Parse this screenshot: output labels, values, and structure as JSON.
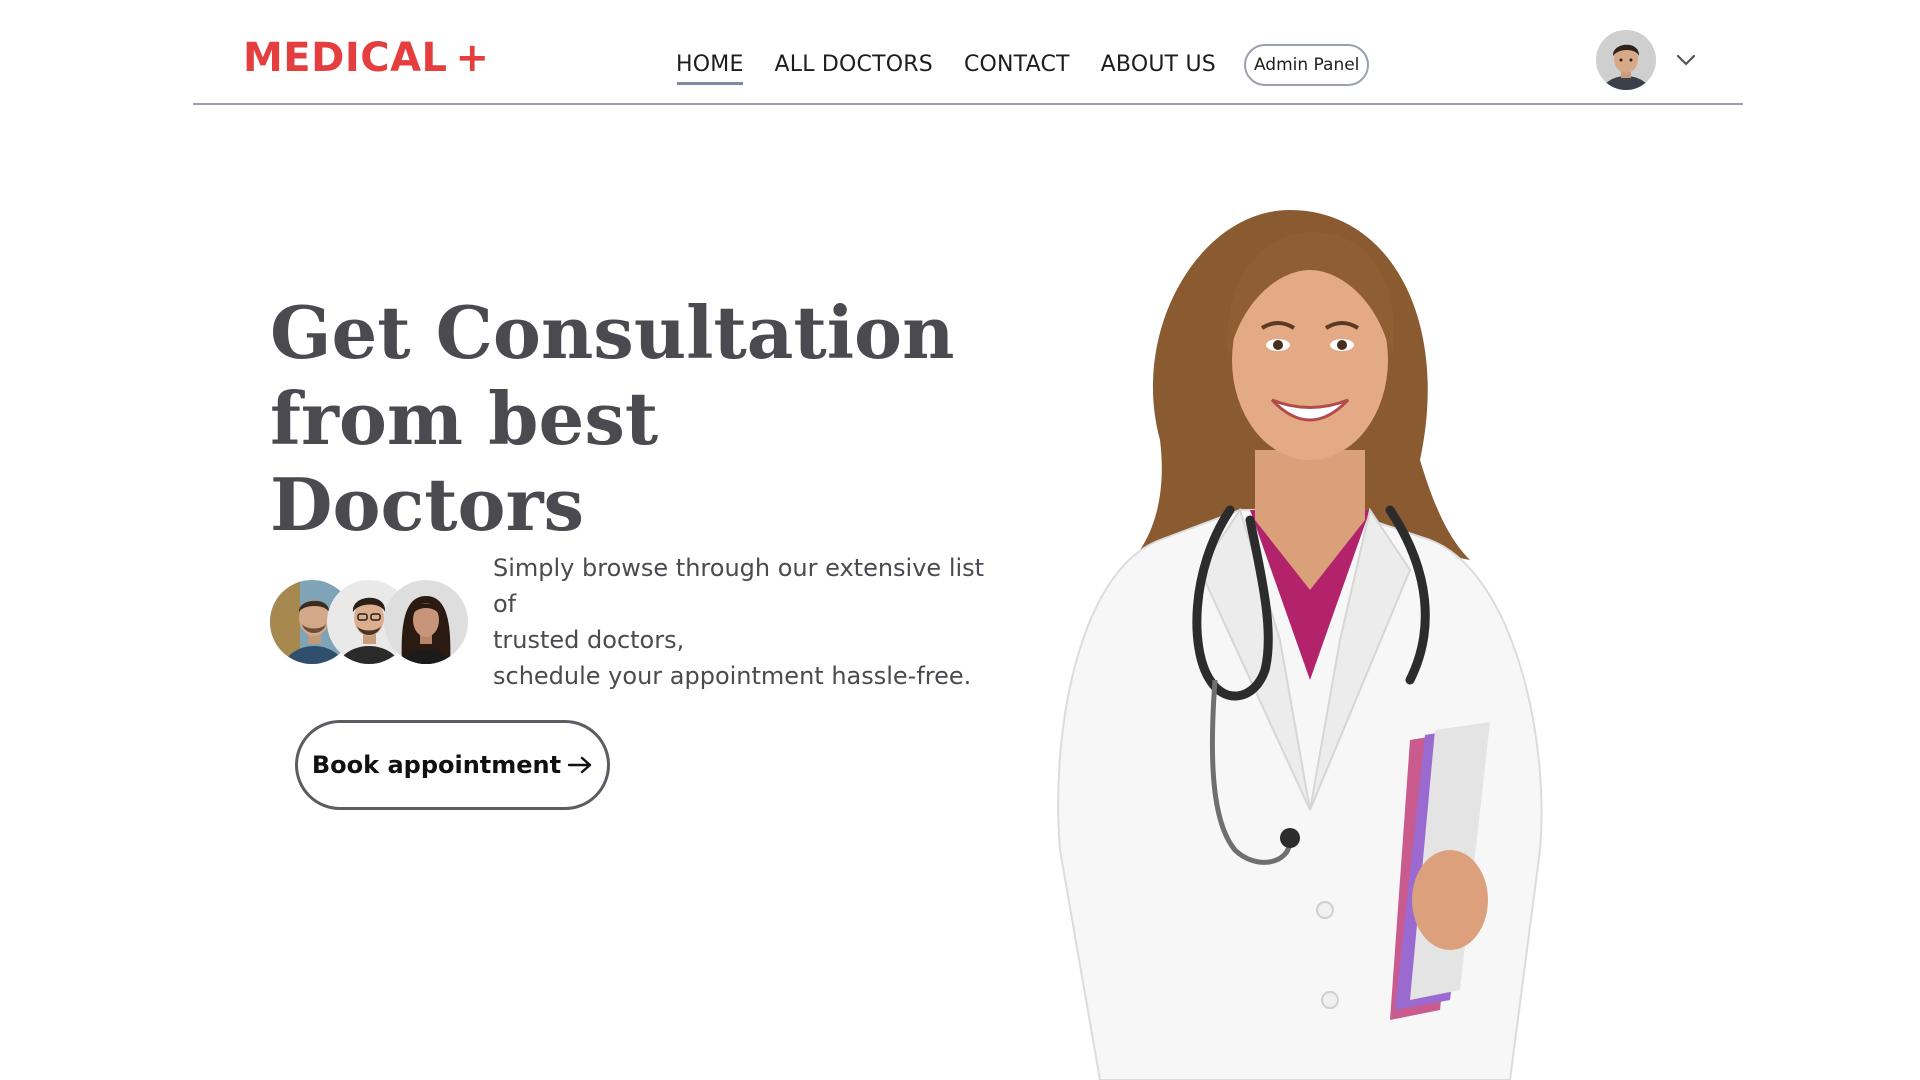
{
  "brand": {
    "name": "MEDICAL",
    "plus": "+",
    "color": "#e53e3e"
  },
  "nav": {
    "links": [
      {
        "label": "HOME",
        "active": true
      },
      {
        "label": "ALL DOCTORS",
        "active": false
      },
      {
        "label": "CONTACT",
        "active": false
      },
      {
        "label": "ABOUT US",
        "active": false
      }
    ],
    "admin_label": "Admin Panel"
  },
  "profile": {
    "avatar_icon": "user-avatar",
    "menu_icon": "chevron-down-icon"
  },
  "hero": {
    "title_lines": [
      "Get Consultation",
      "from best",
      "Doctors"
    ],
    "description_lines": [
      "Simply browse through our extensive list",
      "of",
      "trusted doctors,",
      "schedule your appointment hassle-free."
    ],
    "cta_label": "Book appointment",
    "cta_icon": "arrow-right-icon"
  },
  "colors": {
    "text": "#4a4a50",
    "border": "#9aa0ad",
    "accent": "#e53e3e"
  }
}
